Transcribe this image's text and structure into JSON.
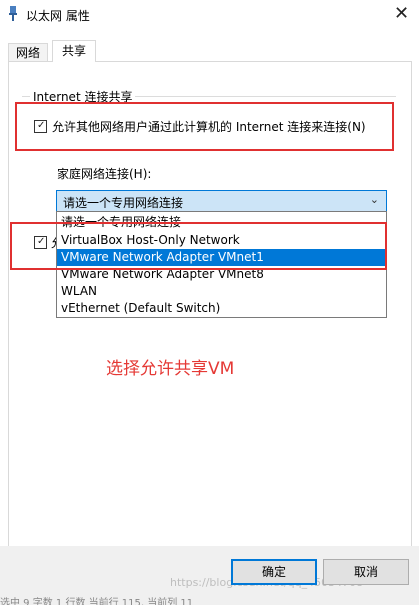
{
  "window": {
    "title": "以太网 属性",
    "close_glyph": "✕",
    "title_icon": "network-adapter-icon"
  },
  "tabs": [
    {
      "label": "网络"
    },
    {
      "label": "共享"
    }
  ],
  "group": {
    "title": "Internet 连接共享"
  },
  "options": {
    "allow_share_label": "允许其他网络用户通过此计算机的 Internet 连接来连接(N)",
    "allow_share_checked": true,
    "home_network_label": "家庭网络连接(H):",
    "second_checked": true,
    "second_label_fragment": "允"
  },
  "combo": {
    "value": "请选一个专用网络连接",
    "arrow": "⌄"
  },
  "dropdown": {
    "items": [
      {
        "label": "请选一个专用网络连接"
      },
      {
        "label": "VirtualBox Host-Only Network"
      },
      {
        "label": "VMware Network Adapter VMnet1",
        "selected": true
      },
      {
        "label": "VMware Network Adapter VMnet8"
      },
      {
        "label": "WLAN"
      },
      {
        "label": "vEthernet (Default Switch)"
      }
    ]
  },
  "annotation": "选择允许共享VM",
  "buttons": {
    "ok": "确定",
    "cancel": "取消"
  },
  "statusbar": "选中 9 字数 1 行数 当前行 115, 当前列 11",
  "watermark": "https://blog.csdn.net/qq_45034708",
  "colors": {
    "accent": "#0078d7",
    "highlight_red": "#e03030",
    "annotation_red": "#e53935"
  }
}
